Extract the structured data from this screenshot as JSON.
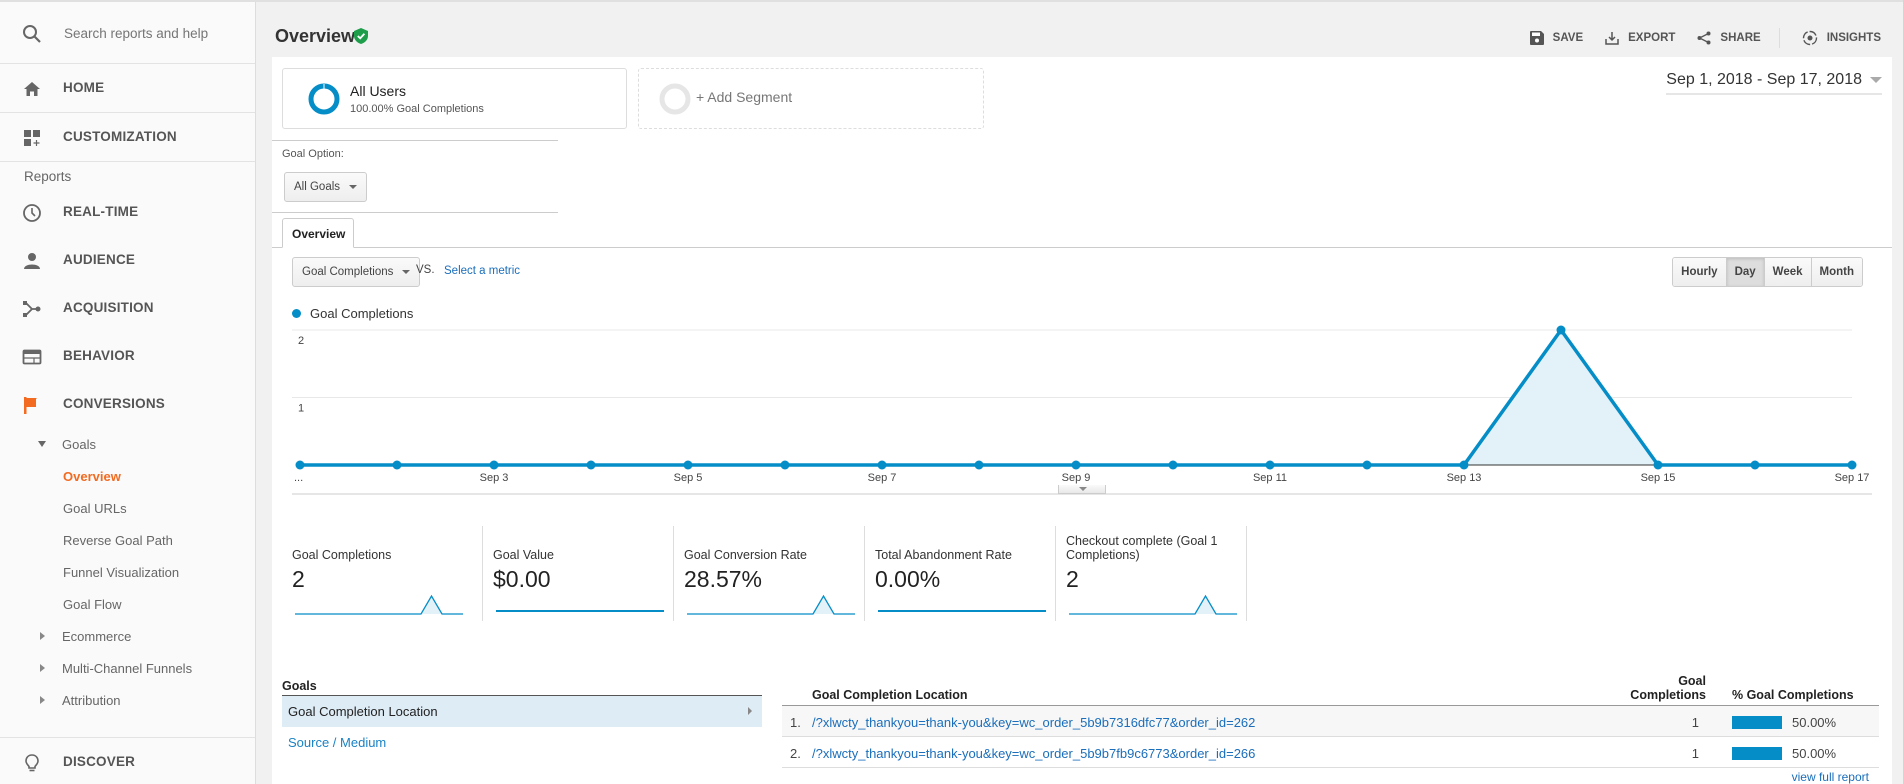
{
  "sidebar": {
    "search_placeholder": "Search reports and help",
    "home": "HOME",
    "customization": "CUSTOMIZATION",
    "reports_heading": "Reports",
    "nav": [
      {
        "label": "REAL-TIME",
        "icon": "clock-icon"
      },
      {
        "label": "AUDIENCE",
        "icon": "person-icon"
      },
      {
        "label": "ACQUISITION",
        "icon": "acquisition-icon"
      },
      {
        "label": "BEHAVIOR",
        "icon": "behavior-icon"
      },
      {
        "label": "CONVERSIONS",
        "icon": "flag-icon"
      }
    ],
    "conversions_tree": {
      "goals": "Goals",
      "goals_items": [
        "Overview",
        "Goal URLs",
        "Reverse Goal Path",
        "Funnel Visualization",
        "Goal Flow"
      ],
      "active_item": "Overview",
      "collapsed": [
        "Ecommerce",
        "Multi-Channel Funnels",
        "Attribution"
      ]
    },
    "discover": "DISCOVER",
    "active_color": "#f26b21"
  },
  "header": {
    "title": "Overview",
    "actions": {
      "save": "SAVE",
      "export": "EXPORT",
      "share": "SHARE",
      "insights": "INSIGHTS"
    }
  },
  "segments": {
    "active": {
      "name": "All Users",
      "sub": "100.00% Goal Completions"
    },
    "add_label": "+ Add Segment"
  },
  "date_range": "Sep 1, 2018 - Sep 17, 2018",
  "goal_option": {
    "label": "Goal Option:",
    "selected": "All Goals"
  },
  "tabs": [
    {
      "label": "Overview",
      "active": true
    }
  ],
  "metric_selector": {
    "selected": "Goal Completions",
    "vs": "VS.",
    "select_metric": "Select a metric"
  },
  "time_granularity": {
    "options": [
      "Hourly",
      "Day",
      "Week",
      "Month"
    ],
    "selected": "Day"
  },
  "chart_data": {
    "type": "area",
    "legend": [
      "Goal Completions"
    ],
    "x": [
      "Sep 1",
      "Sep 2",
      "Sep 3",
      "Sep 4",
      "Sep 5",
      "Sep 6",
      "Sep 7",
      "Sep 8",
      "Sep 9",
      "Sep 10",
      "Sep 11",
      "Sep 12",
      "Sep 13",
      "Sep 14",
      "Sep 15",
      "Sep 16",
      "Sep 17"
    ],
    "x_tick_labels": [
      "...",
      "",
      "Sep 3",
      "",
      "Sep 5",
      "",
      "Sep 7",
      "",
      "Sep 9",
      "",
      "Sep 11",
      "",
      "Sep 13",
      "",
      "Sep 15",
      "",
      "Sep 17"
    ],
    "series": [
      {
        "name": "Goal Completions",
        "values": [
          0,
          0,
          0,
          0,
          0,
          0,
          0,
          0,
          0,
          0,
          0,
          0,
          0,
          2,
          0,
          0,
          0
        ],
        "color": "#058dc7"
      }
    ],
    "y_ticks": [
      "1",
      "2"
    ],
    "ylim": [
      0,
      2
    ],
    "grid": true,
    "legend_position": "top-left"
  },
  "scorecards": [
    {
      "title": "Goal Completions",
      "value": "2",
      "spark": [
        0,
        0,
        0,
        0,
        0,
        0,
        0,
        0,
        0,
        0,
        0,
        0,
        0,
        2,
        0,
        0,
        0
      ]
    },
    {
      "title": "Goal Value",
      "value": "$0.00",
      "spark": [
        0,
        0,
        0,
        0,
        0,
        0,
        0,
        0,
        0,
        0,
        0,
        0,
        0,
        0,
        0,
        0,
        0
      ]
    },
    {
      "title": "Goal Conversion Rate",
      "value": "28.57%",
      "spark": [
        0,
        0,
        0,
        0,
        0,
        0,
        0,
        0,
        0,
        0,
        0,
        0,
        0,
        2,
        0,
        0,
        0
      ]
    },
    {
      "title": "Total Abandonment Rate",
      "value": "0.00%",
      "spark": [
        0,
        0,
        0,
        0,
        0,
        0,
        0,
        0,
        0,
        0,
        0,
        0,
        0,
        0,
        0,
        0,
        0
      ]
    },
    {
      "title": "Checkout complete (Goal 1 Completions)",
      "value": "2",
      "spark": [
        0,
        0,
        0,
        0,
        0,
        0,
        0,
        0,
        0,
        0,
        0,
        0,
        0,
        2,
        0,
        0,
        0
      ]
    }
  ],
  "goals_panel": {
    "heading": "Goals",
    "items": [
      {
        "label": "Goal Completion Location",
        "selected": true
      },
      {
        "label": "Source / Medium",
        "selected": false
      }
    ]
  },
  "table": {
    "headers": {
      "location": "Goal Completion Location",
      "completions": "Goal Completions",
      "pct": "% Goal Completions"
    },
    "rows": [
      {
        "num": "1.",
        "location": "/?xlwcty_thankyou=thank-you&key=wc_order_5b9b7316dfc77&order_id=262",
        "completions": "1",
        "pct": "50.00%",
        "pct_value": 0.5
      },
      {
        "num": "2.",
        "location": "/?xlwcty_thankyou=thank-you&key=wc_order_5b9b7fb9c6773&order_id=266",
        "completions": "1",
        "pct": "50.00%",
        "pct_value": 0.5
      }
    ],
    "view_full": "view full report"
  }
}
